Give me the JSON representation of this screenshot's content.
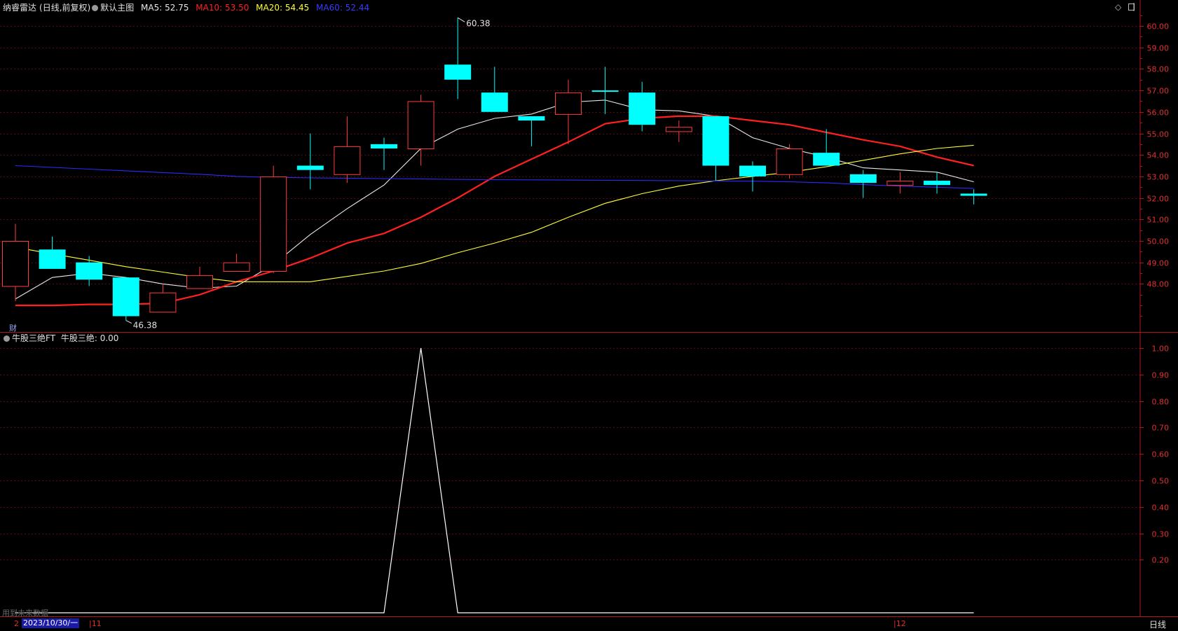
{
  "header": {
    "stock_name": "纳睿雷达",
    "period": "(日线,前复权)",
    "main_indicator": "默认主图",
    "ma5": "MA5: 52.75",
    "ma10": "MA10: 53.50",
    "ma20": "MA20: 54.45",
    "ma60": "MA60: 52.44"
  },
  "indicator": {
    "name": "牛股三绝FT",
    "value_label": "牛股三绝: 0.00"
  },
  "badge_finance": "财",
  "future_data_text": "用到未来数据",
  "bottom": {
    "date_label": "2023/10/30/一",
    "month_nov": "11",
    "month_dec": "12",
    "month_oct_partial": "2",
    "period_button": "日线"
  },
  "colors": {
    "background": "#000000",
    "up": "#ff3b3b",
    "down": "#00ffff",
    "ma5": "#e8e8e8",
    "ma10": "#ff2020",
    "ma20": "#ffff33",
    "ma60": "#2b2bff",
    "indicator_line": "#ffffff",
    "axis": "#b01818"
  },
  "chart_data": [
    {
      "type": "candlestick",
      "title": "纳睿雷达 (日线,前复权)",
      "ylim": [
        46.0,
        60.6
      ],
      "y_ticks": [
        48,
        49,
        50,
        51,
        52,
        53,
        54,
        55,
        56,
        57,
        58,
        59,
        60
      ],
      "y_tick_labels": [
        "48.00",
        "49.00",
        "50.00",
        "51.00",
        "52.00",
        "53.00",
        "54.00",
        "55.00",
        "56.00",
        "57.00",
        "58.00",
        "59.00",
        "60.00"
      ],
      "annotations": [
        {
          "text": "60.38",
          "type": "high"
        },
        {
          "text": "46.38",
          "type": "low"
        }
      ],
      "candles": [
        {
          "open": 47.9,
          "close": 50.0,
          "high": 50.8,
          "low": 47.2
        },
        {
          "open": 49.6,
          "close": 48.7,
          "high": 50.2,
          "low": 48.7
        },
        {
          "open": 49.0,
          "close": 48.2,
          "high": 49.3,
          "low": 47.9
        },
        {
          "open": 48.3,
          "close": 46.5,
          "high": 48.3,
          "low": 46.3
        },
        {
          "open": 46.7,
          "close": 47.6,
          "high": 48.0,
          "low": 46.7
        },
        {
          "open": 47.8,
          "close": 48.4,
          "high": 48.8,
          "low": 47.8
        },
        {
          "open": 48.6,
          "close": 49.0,
          "high": 49.4,
          "low": 48.6
        },
        {
          "open": 48.6,
          "close": 53.0,
          "high": 53.5,
          "low": 48.5
        },
        {
          "open": 53.5,
          "close": 53.3,
          "high": 55.0,
          "low": 52.4
        },
        {
          "open": 53.1,
          "close": 54.4,
          "high": 55.8,
          "low": 52.7
        },
        {
          "open": 54.5,
          "close": 54.3,
          "high": 54.8,
          "low": 53.3
        },
        {
          "open": 54.3,
          "close": 56.5,
          "high": 56.8,
          "low": 53.5
        },
        {
          "open": 58.2,
          "close": 57.5,
          "high": 60.38,
          "low": 56.6
        },
        {
          "open": 56.9,
          "close": 56.0,
          "high": 58.1,
          "low": 56.0
        },
        {
          "open": 55.8,
          "close": 55.6,
          "high": 55.8,
          "low": 54.4
        },
        {
          "open": 55.9,
          "close": 56.9,
          "high": 57.5,
          "low": 54.5
        },
        {
          "open": 57.0,
          "close": 56.95,
          "high": 58.1,
          "low": 55.9
        },
        {
          "open": 56.9,
          "close": 55.4,
          "high": 57.4,
          "low": 55.1
        },
        {
          "open": 55.1,
          "close": 55.3,
          "high": 55.6,
          "low": 54.6
        },
        {
          "open": 55.8,
          "close": 53.5,
          "high": 55.8,
          "low": 52.8
        },
        {
          "open": 53.5,
          "close": 53.0,
          "high": 53.7,
          "low": 52.3
        },
        {
          "open": 53.1,
          "close": 54.3,
          "high": 54.5,
          "low": 52.9
        },
        {
          "open": 54.1,
          "close": 53.5,
          "high": 55.2,
          "low": 53.5
        },
        {
          "open": 53.1,
          "close": 52.7,
          "high": 53.3,
          "low": 52.0
        },
        {
          "open": 52.6,
          "close": 52.8,
          "high": 53.2,
          "low": 52.2
        },
        {
          "open": 52.8,
          "close": 52.6,
          "high": 53.2,
          "low": 52.2
        },
        {
          "open": 52.2,
          "close": 52.1,
          "high": 52.4,
          "low": 51.7
        }
      ],
      "series": [
        {
          "name": "MA5",
          "values": [
            47.3,
            48.3,
            48.5,
            48.3,
            48.0,
            47.8,
            47.9,
            48.9,
            50.3,
            51.5,
            52.6,
            54.3,
            55.2,
            55.7,
            55.9,
            56.45,
            56.55,
            56.1,
            56.05,
            55.8,
            54.8,
            54.3,
            53.9,
            53.4,
            53.3,
            53.2,
            52.75
          ]
        },
        {
          "name": "MA10",
          "values": [
            47.0,
            47.0,
            47.05,
            47.05,
            47.1,
            47.5,
            48.1,
            48.6,
            49.2,
            49.9,
            50.35,
            51.1,
            52.0,
            53.0,
            53.8,
            54.6,
            55.45,
            55.7,
            55.8,
            55.8,
            55.6,
            55.4,
            55.05,
            54.7,
            54.4,
            53.9,
            53.5
          ]
        },
        {
          "name": "MA20",
          "values": [
            49.7,
            49.4,
            49.1,
            48.8,
            48.55,
            48.3,
            48.1,
            48.1,
            48.1,
            48.35,
            48.6,
            48.95,
            49.45,
            49.9,
            50.4,
            51.1,
            51.75,
            52.2,
            52.55,
            52.8,
            53.0,
            53.2,
            53.45,
            53.75,
            54.05,
            54.3,
            54.45
          ]
        },
        {
          "name": "MA60",
          "values": [
            53.5,
            53.42,
            53.34,
            53.26,
            53.18,
            53.1,
            53.0,
            52.96,
            52.93,
            52.92,
            52.9,
            52.88,
            52.86,
            52.85,
            52.84,
            52.83,
            52.82,
            52.81,
            52.8,
            52.79,
            52.78,
            52.75,
            52.7,
            52.62,
            52.55,
            52.5,
            52.44
          ]
        }
      ]
    },
    {
      "type": "line",
      "title": "牛股三绝FT",
      "ylim": [
        0.0,
        1.0
      ],
      "y_tick_labels": [
        "0.20",
        "0.30",
        "0.40",
        "0.50",
        "0.60",
        "0.70",
        "0.80",
        "0.90",
        "1.00"
      ],
      "series": [
        {
          "name": "牛股三绝",
          "values": [
            0,
            0,
            0,
            0,
            0,
            0,
            0,
            0,
            0,
            0,
            0,
            1,
            0,
            0,
            0,
            0,
            0,
            0,
            0,
            0,
            0,
            0,
            0,
            0,
            0,
            0,
            0
          ]
        }
      ]
    }
  ]
}
